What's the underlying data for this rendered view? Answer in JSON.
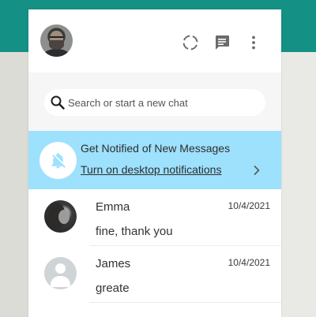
{
  "colors": {
    "app_header": "#159084",
    "notification_banner": "#9de1fd",
    "search_area": "#f6f6f6",
    "icon_gray": "#6b6b6b"
  },
  "header": {
    "icons": [
      "status-icon",
      "new-chat-icon",
      "menu-icon"
    ]
  },
  "search": {
    "placeholder": "Search or start a new chat",
    "value": ""
  },
  "notification": {
    "title": "Get Notified of New Messages",
    "link": "Turn on desktop notifications",
    "icon": "bell-off-icon"
  },
  "chats": [
    {
      "name": "Emma",
      "time": "10/4/2021",
      "message": "fine, thank you"
    },
    {
      "name": "James",
      "time": "10/4/2021",
      "message": "greate"
    }
  ]
}
